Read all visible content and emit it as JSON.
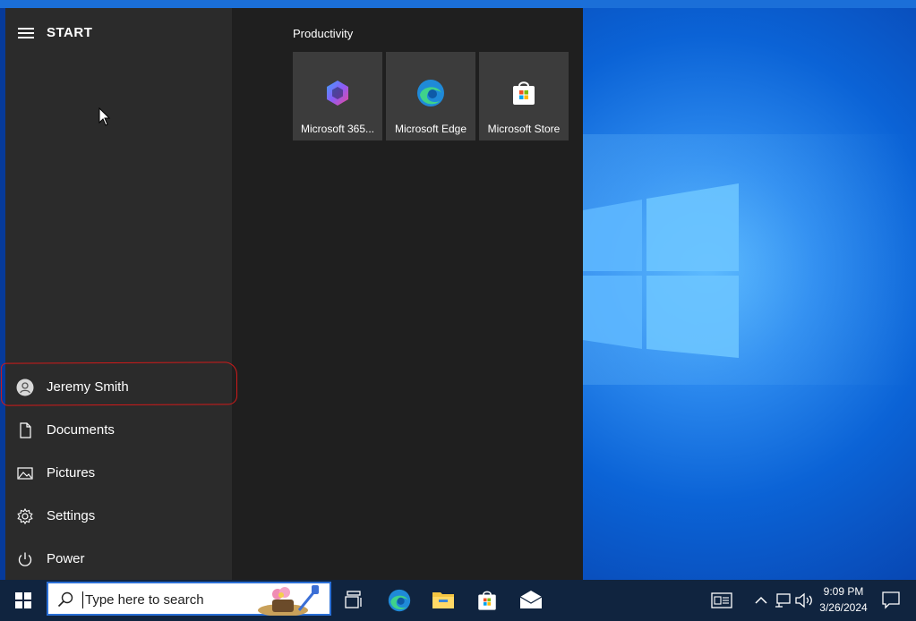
{
  "start_menu": {
    "title": "START",
    "rail": [
      {
        "label": "Jeremy Smith",
        "icon": "user-avatar-icon"
      },
      {
        "label": "Documents",
        "icon": "document-icon"
      },
      {
        "label": "Pictures",
        "icon": "pictures-icon"
      },
      {
        "label": "Settings",
        "icon": "gear-icon"
      },
      {
        "label": "Power",
        "icon": "power-icon"
      }
    ],
    "group": {
      "label": "Productivity",
      "tiles": [
        {
          "label": "Microsoft 365...",
          "icon": "microsoft-365-icon"
        },
        {
          "label": "Microsoft Edge",
          "icon": "edge-icon"
        },
        {
          "label": "Microsoft Store",
          "icon": "store-icon"
        }
      ]
    }
  },
  "taskbar": {
    "search_placeholder": "Type here to search",
    "apps": [
      "task-view-icon",
      "edge-icon",
      "file-explorer-icon",
      "store-icon",
      "mail-icon"
    ],
    "clock": {
      "time": "9:09 PM",
      "date": "3/26/2024"
    }
  },
  "colors": {
    "annotation": "#d11a1a",
    "taskbar": "#10243f",
    "tile": "#3c3c3c"
  }
}
